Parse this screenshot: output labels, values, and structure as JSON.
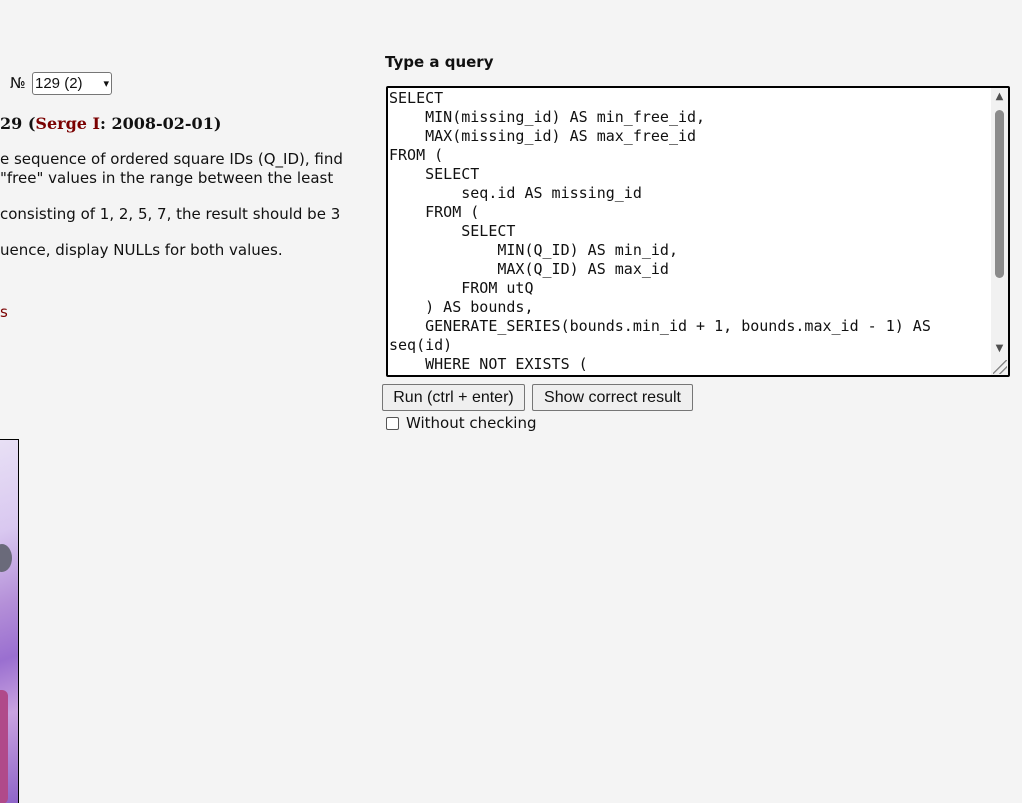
{
  "task": {
    "number_label": "№",
    "select_value": "129 (2)",
    "title_prefix": "29 (",
    "author": "Serge I",
    "title_suffix": ": 2008-02-01)"
  },
  "description": {
    "line1": "e sequence of ordered square IDs (Q_ID), find",
    "line2": "\"free\" values in the range between the least",
    "line3": " consisting of 1, 2, 5, 7, the result should be 3",
    "line4": "uence, display NULLs for both values."
  },
  "left_link": "s",
  "query": {
    "label": "Type a query",
    "text": "SELECT\n    MIN(missing_id) AS min_free_id,\n    MAX(missing_id) AS max_free_id\nFROM (\n    SELECT\n        seq.id AS missing_id\n    FROM (\n        SELECT\n            MIN(Q_ID) AS min_id,\n            MAX(Q_ID) AS max_id\n        FROM utQ\n    ) AS bounds,\n    GENERATE_SERIES(bounds.min_id + 1, bounds.max_id - 1) AS\nseq(id)\n    WHERE NOT EXISTS ("
  },
  "buttons": {
    "run": "Run (ctrl + enter)",
    "show": "Show correct result"
  },
  "checkbox": {
    "label": "Without checking",
    "checked": false
  },
  "colors": {
    "author": "#7a0000",
    "background": "#f4f4f4"
  }
}
